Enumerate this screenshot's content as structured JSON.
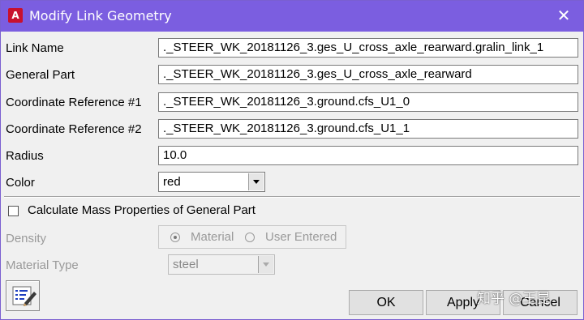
{
  "window": {
    "title": "Modify Link Geometry",
    "app_icon_letter": "A"
  },
  "fields": {
    "link_name": {
      "label": "Link Name",
      "value": "._STEER_WK_20181126_3.ges_U_cross_axle_rearward.gralin_link_1"
    },
    "general_part": {
      "label": "General Part",
      "value": "._STEER_WK_20181126_3.ges_U_cross_axle_rearward"
    },
    "coord_ref_1": {
      "label": "Coordinate Reference #1",
      "value": "._STEER_WK_20181126_3.ground.cfs_U1_0"
    },
    "coord_ref_2": {
      "label": "Coordinate Reference #2",
      "value": "._STEER_WK_20181126_3.ground.cfs_U1_1"
    },
    "radius": {
      "label": "Radius",
      "value": "10.0"
    },
    "color": {
      "label": "Color",
      "value": "red"
    }
  },
  "mass": {
    "checkbox_label": "Calculate Mass Properties of General Part",
    "checked": false,
    "density_label": "Density",
    "density_options": [
      "Material",
      "User Entered"
    ],
    "density_selected": "Material",
    "material_type_label": "Material Type",
    "material_type_value": "steel"
  },
  "buttons": {
    "ok": "OK",
    "apply": "Apply",
    "cancel": "Cancel"
  },
  "watermark": "知乎 @王昆",
  "colors": {
    "titlebar": "#7b5ee0",
    "app_icon": "#c8102e"
  }
}
